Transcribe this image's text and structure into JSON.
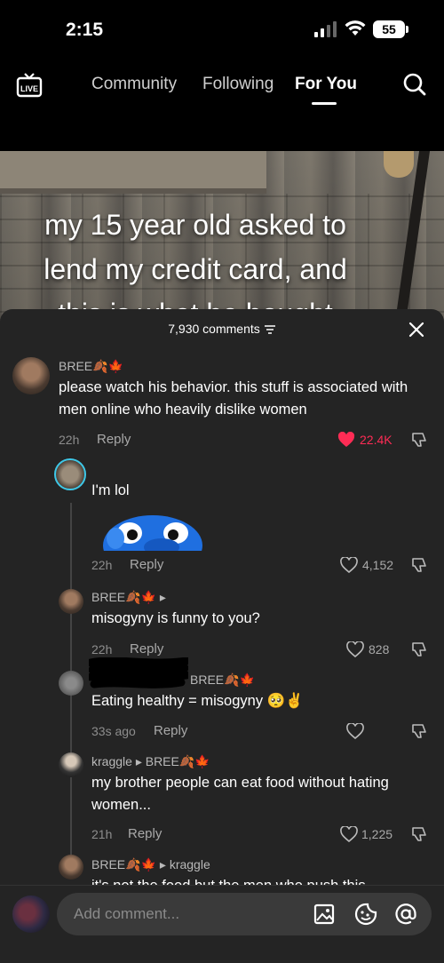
{
  "status_bar": {
    "time": "2:15",
    "battery": "55"
  },
  "topnav": {
    "live_label": "LIVE",
    "tabs": [
      {
        "label": "Community"
      },
      {
        "label": "Following"
      },
      {
        "label": "For You"
      }
    ]
  },
  "video": {
    "caption_lines": [
      "my 15 year old asked to",
      "lend my credit card, and",
      "this is what he bought"
    ]
  },
  "comments_sheet": {
    "count_label": "7,930 comments",
    "comments": [
      {
        "username": "BREE🍂🍁",
        "text": "please watch his behavior. this stuff is associated with men online who heavily dislike women",
        "time": "22h",
        "reply": "Reply",
        "likes": "22.4K"
      },
      {
        "username": "",
        "text": "I'm lol",
        "time": "22h",
        "reply": "Reply",
        "likes": "4,152"
      },
      {
        "username": "BREE🍂🍁",
        "text": "misogyny is funny to you?",
        "time": "22h",
        "reply": "Reply",
        "likes": "828"
      },
      {
        "username": "BREE🍂🍁",
        "text": "Eating healthy = misogyny 🥺✌️",
        "time": "33s ago",
        "reply": "Reply",
        "likes": ""
      },
      {
        "username": "kraggle",
        "reply_to": "BREE🍂🍁",
        "text": "my brother people can eat food without hating women...",
        "time": "21h",
        "reply": "Reply",
        "likes": "1,225"
      },
      {
        "username": "BREE🍂🍁",
        "reply_to": "kraggle",
        "text": "it's not the food but the men who push this"
      }
    ]
  },
  "input": {
    "placeholder": "Add comment..."
  },
  "colors": {
    "like_active": "#fe2c55",
    "sheet_bg": "#242424",
    "input_bg": "#3a3a3a"
  }
}
